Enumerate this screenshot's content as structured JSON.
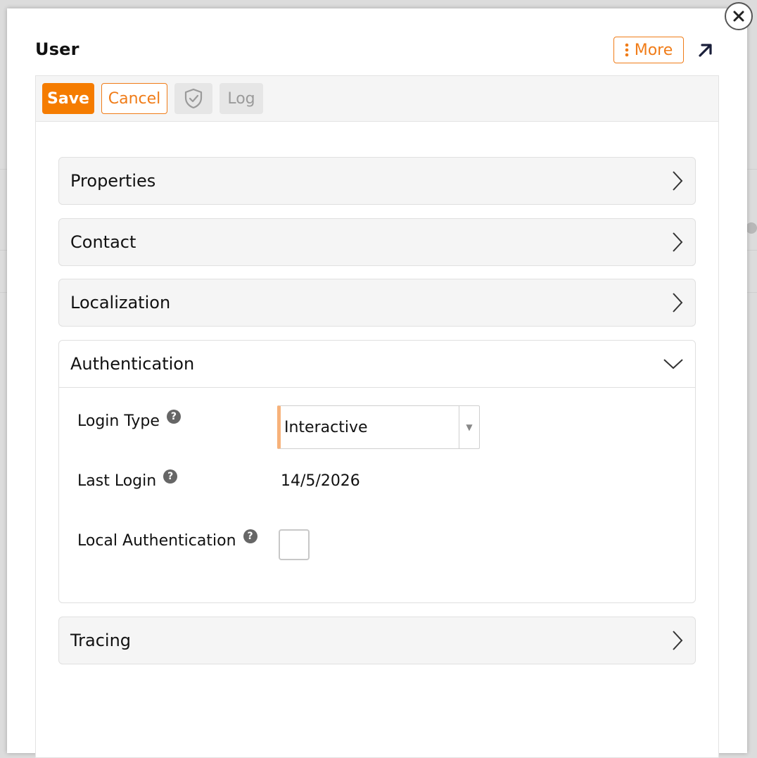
{
  "dialog": {
    "title": "User",
    "more_label": "More"
  },
  "toolbar": {
    "save_label": "Save",
    "cancel_label": "Cancel",
    "log_label": "Log"
  },
  "sections": {
    "properties": {
      "title": "Properties",
      "expanded": false
    },
    "contact": {
      "title": "Contact",
      "expanded": false
    },
    "localization": {
      "title": "Localization",
      "expanded": false
    },
    "authentication": {
      "title": "Authentication",
      "expanded": true,
      "fields": {
        "login_type": {
          "label": "Login Type",
          "value": "Interactive"
        },
        "last_login": {
          "label": "Last Login",
          "value": "14/5/2026"
        },
        "local_authentication": {
          "label": "Local Authentication",
          "checked": false
        }
      }
    },
    "tracing": {
      "title": "Tracing",
      "expanded": false
    }
  },
  "colors": {
    "accent": "#f57c00",
    "accent_light": "#f7b27a"
  },
  "icons": {
    "close": "close-icon",
    "more": "kebab-icon",
    "expand": "arrow-up-right-icon",
    "shield": "shield-check-icon",
    "help": "help-icon",
    "collapsed": "chevron-right-icon",
    "expanded": "chevron-down-icon"
  }
}
